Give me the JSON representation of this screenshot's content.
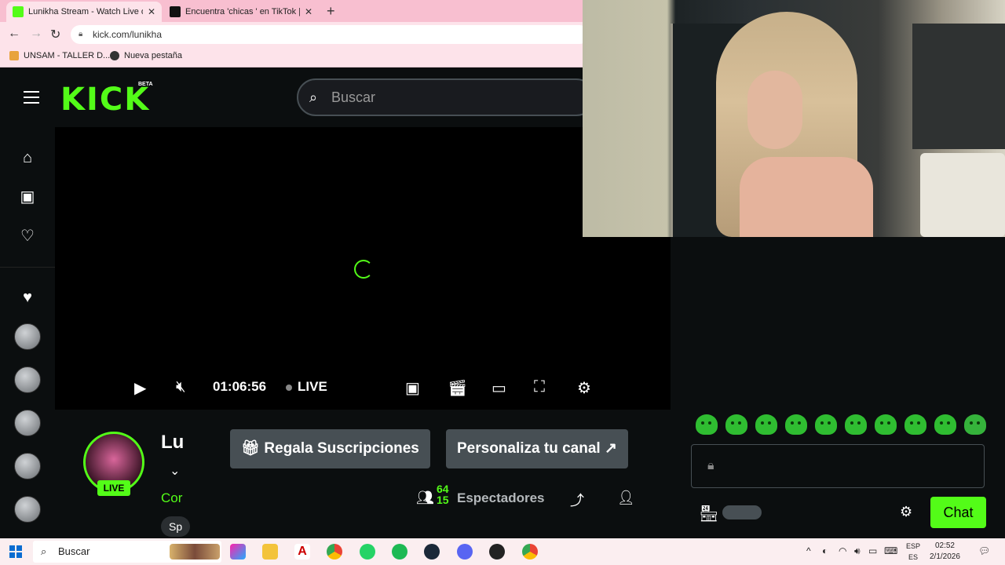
{
  "browser": {
    "tabs": [
      {
        "title": "Lunikha Stream - Watch Live on K"
      },
      {
        "title": "Encuentra 'chicas ' en TikTok | Bu"
      }
    ],
    "url": "kick.com/lunikha",
    "bookmarks": [
      {
        "label": "UNSAM - TALLER D..."
      },
      {
        "label": "Nueva pestaña"
      }
    ]
  },
  "header": {
    "logo_text": "KICK",
    "beta_label": "BETA",
    "search_placeholder": "Buscar"
  },
  "player": {
    "time": "01:06:56",
    "live_label": "LIVE"
  },
  "channel": {
    "name_partial": "Lu",
    "live_badge": "LIVE",
    "category_partial": "Cor",
    "tag_partial": "Sp",
    "gift_button": "Regala Suscripciones",
    "customize_button": "Personaliza tu canal",
    "viewer_count_partial": "64 15",
    "viewers_label": "Espectadores"
  },
  "chat": {
    "chat_button": "Chat"
  },
  "taskbar": {
    "search_label": "Buscar",
    "lang_line1": "ESP",
    "lang_line2": "ES",
    "time": "02:52",
    "date": "2/1/2026"
  },
  "colors": {
    "kick_green": "#53fc18",
    "tabbar_pink": "#f8bfd0"
  }
}
